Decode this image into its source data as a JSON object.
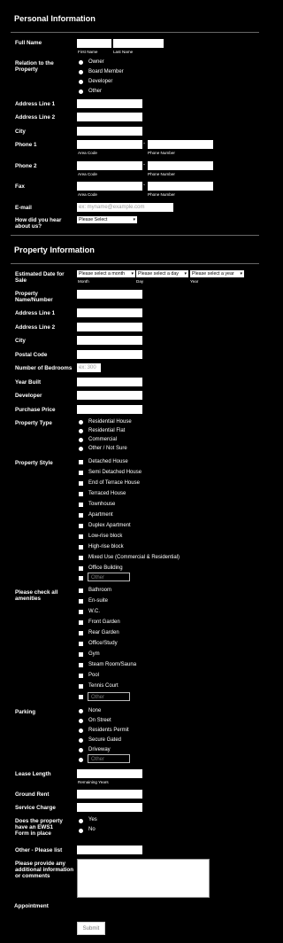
{
  "personal": {
    "heading": "Personal Information",
    "full_name": "Full Name",
    "first_name": "First Name",
    "last_name": "Last Name",
    "relation": "Relation to the Property",
    "relation_options": [
      "Owner",
      "Board Member",
      "Developer",
      "Other"
    ],
    "address1": "Address Line 1",
    "address2": "Address Line 2",
    "city": "City",
    "phone1": "Phone 1",
    "phone2": "Phone 2",
    "fax": "Fax",
    "area_code": "Area Code",
    "phone_number": "Phone Number",
    "email": "E-mail",
    "email_placeholder": "ex: myname@example.com",
    "hear": "How did you hear about us?",
    "hear_select": "Please Select"
  },
  "property": {
    "heading": "Property Information",
    "est_date": "Estimated Date for Sale",
    "month_select": "Please select a month",
    "day_select": "Please select a day",
    "year_select": "Please select a year",
    "month": "Month",
    "day": "Day",
    "year": "Year",
    "name": "Property Name/Number",
    "address1": "Address Line 1",
    "address2": "Address Line 2",
    "city": "City",
    "postal": "Postal Code",
    "bedrooms": "Number of Bedrooms",
    "bedrooms_placeholder": "ex: 300",
    "year_built": "Year Built",
    "developer": "Developer",
    "purchase_price": "Purchase Price",
    "type": "Property Type",
    "type_options": [
      "Residential House",
      "Residential Flat",
      "Commercial",
      "Other / Not Sure"
    ],
    "style": "Property Style",
    "style_options": [
      "Detached House",
      "Semi Detached House",
      "End of Terrace House",
      "Terraced House",
      "Townhouse",
      "Apartment",
      "Duplex Apartment",
      "Low-rise block",
      "High-rise block",
      "Mixed Use (Commercial & Residential)",
      "Office Building"
    ],
    "other_placeholder": "Other",
    "amenities": "Please check all amenities",
    "amenity_options": [
      "Bathroom",
      "En-suite",
      "W.C.",
      "Front Garden",
      "Rear Garden",
      "Office/Study",
      "Gym",
      "Steam Room/Sauna",
      "Pool",
      "Tennis Court"
    ],
    "parking": "Parking",
    "parking_options": [
      "None",
      "On Street",
      "Residents Permit",
      "Secure Gated",
      "Driveway"
    ],
    "lease": "Lease Length",
    "remaining_years": "Remaining Years",
    "ground_rent": "Ground Rent",
    "service_charge": "Service Charge",
    "ews1": "Does the property have an EWS1 Form in place",
    "ews1_options": [
      "Yes",
      "No"
    ],
    "other_list": "Other - Please list",
    "additional": "Please provide any additional information or comments",
    "appointment": "Appointment",
    "submit": "Submit"
  }
}
